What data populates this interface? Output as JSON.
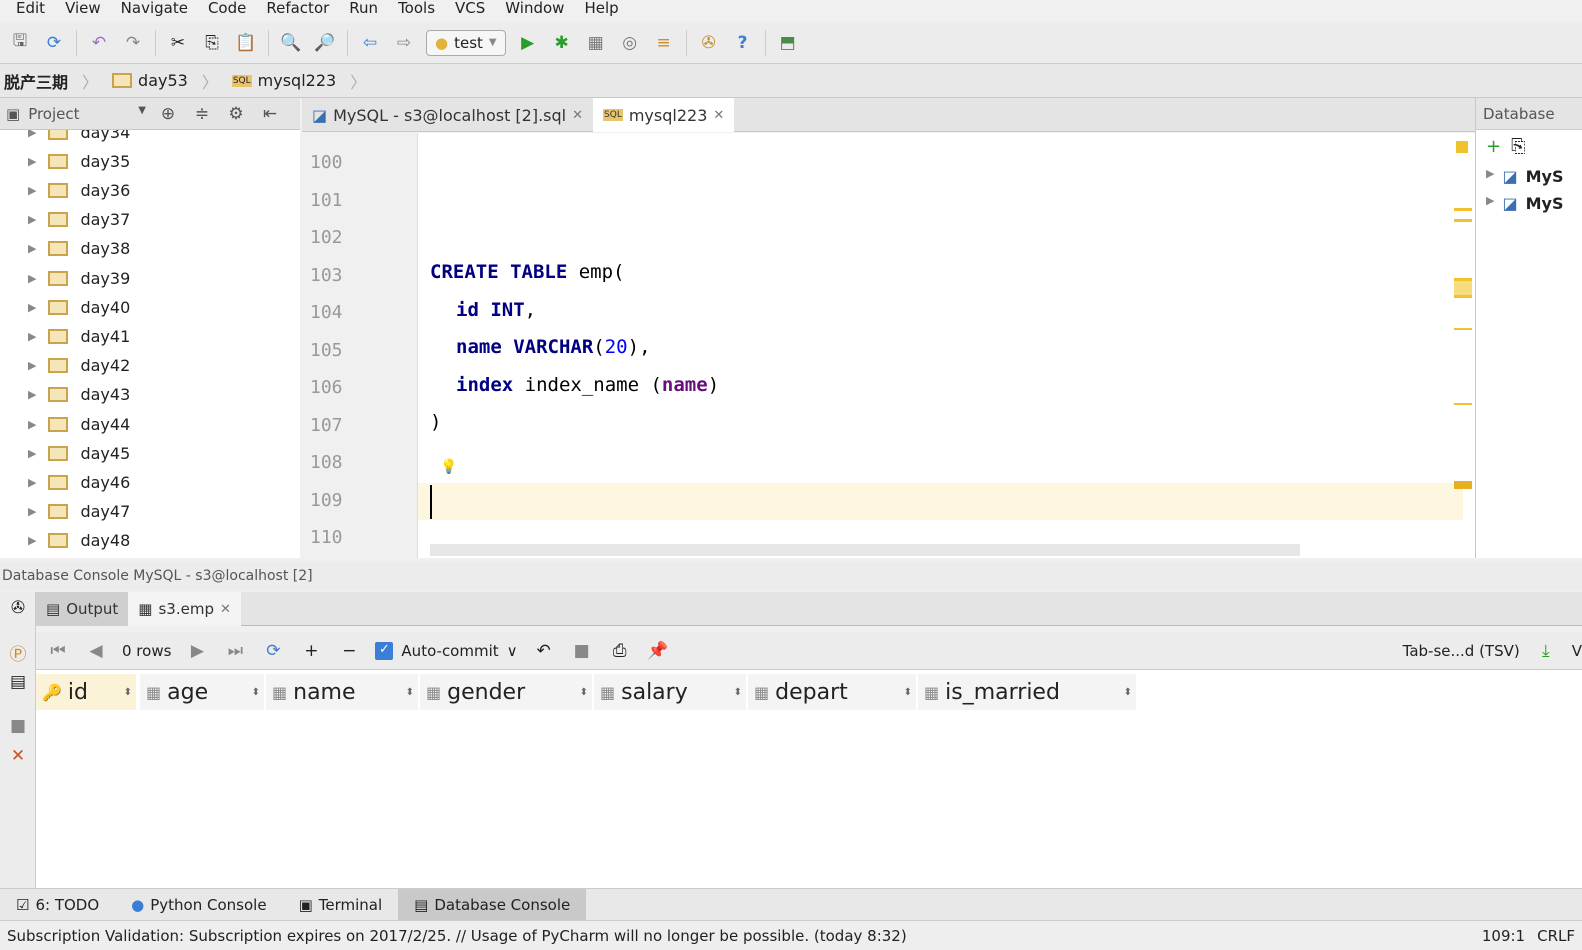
{
  "menu": [
    "Edit",
    "View",
    "Navigate",
    "Code",
    "Refactor",
    "Run",
    "Tools",
    "VCS",
    "Window",
    "Help"
  ],
  "toolbar": {
    "run_config": "test"
  },
  "breadcrumb": [
    "脱产三期",
    "day53",
    "mysql223"
  ],
  "project": {
    "title": "Project",
    "items": [
      "day34",
      "day35",
      "day36",
      "day37",
      "day38",
      "day39",
      "day40",
      "day41",
      "day42",
      "day43",
      "day44",
      "day45",
      "day46",
      "day47",
      "day48"
    ]
  },
  "editor_tabs": [
    {
      "label": "MySQL - s3@localhost [2].sql"
    },
    {
      "label": "mysql223",
      "active": true
    }
  ],
  "line_numbers": [
    "100",
    "101",
    "102",
    "103",
    "104",
    "105",
    "106",
    "107",
    "108",
    "109",
    "110"
  ],
  "code": {
    "l103a": "CREATE TABLE ",
    "l103b": "emp(",
    "l104a": "id ",
    "l104b": "INT",
    ",": ",",
    "l105a": "name ",
    "l105b": "VARCHAR",
    "l105c": "(",
    "l105d": "20",
    "l105e": "),",
    "l106a": "index ",
    "l106b": "index_name (",
    "l106c": "name",
    "l106d": ")",
    "l107": ")"
  },
  "database_panel": {
    "title": "Database",
    "items": [
      "MyS",
      "MyS"
    ]
  },
  "console": {
    "title": "Database Console MySQL - s3@localhost [2]",
    "tabs": [
      "Output",
      "s3.emp"
    ],
    "rows": "0 rows",
    "autocommit": "Auto-commit",
    "autocommit_checked": true,
    "export": "Tab-se...d (TSV)",
    "v": "V",
    "columns": [
      "id",
      "age",
      "name",
      "gender",
      "salary",
      "depart",
      "is_married"
    ]
  },
  "bottom_tabs": [
    "6: TODO",
    "Python Console",
    "Terminal",
    "Database Console"
  ],
  "status": {
    "message": "Subscription Validation: Subscription expires on 2017/2/25. // Usage of PyCharm will no longer be possible. (today 8:32)",
    "position": "109:1",
    "line_sep": "CRLF"
  }
}
